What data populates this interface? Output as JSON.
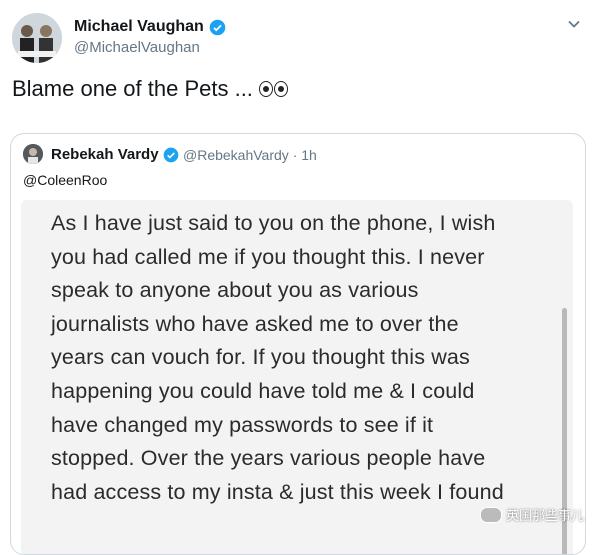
{
  "tweet": {
    "author_name": "Michael Vaughan",
    "author_handle": "@MichaelVaughan",
    "text": "Blame one of the Pets ..."
  },
  "quoted": {
    "author_name": "Rebekah Vardy",
    "author_handle": "@RebekahVardy",
    "time": "· 1h",
    "reply_to": "@ColeenRoo",
    "note_lines": [
      "As I have just said to you on the phone, I wish",
      "you had called me if you thought this. I never",
      "speak to anyone about you as various",
      "journalists who have asked me to over the",
      "years can vouch for. If you thought this was",
      "happening you could have told me & I could",
      "have changed my passwords to see if it",
      "stopped. Over the years various people have",
      "had access to my insta & just this week I found"
    ]
  },
  "watermark": {
    "text": "英国那些事儿"
  },
  "colors": {
    "verified": "#1da1f2",
    "secondary_text": "#657786",
    "border": "#cfd9de"
  },
  "icons": {
    "verified": "verified-badge-icon",
    "menu": "chevron-down-icon",
    "eyes": "eyes-emoji-icon"
  }
}
